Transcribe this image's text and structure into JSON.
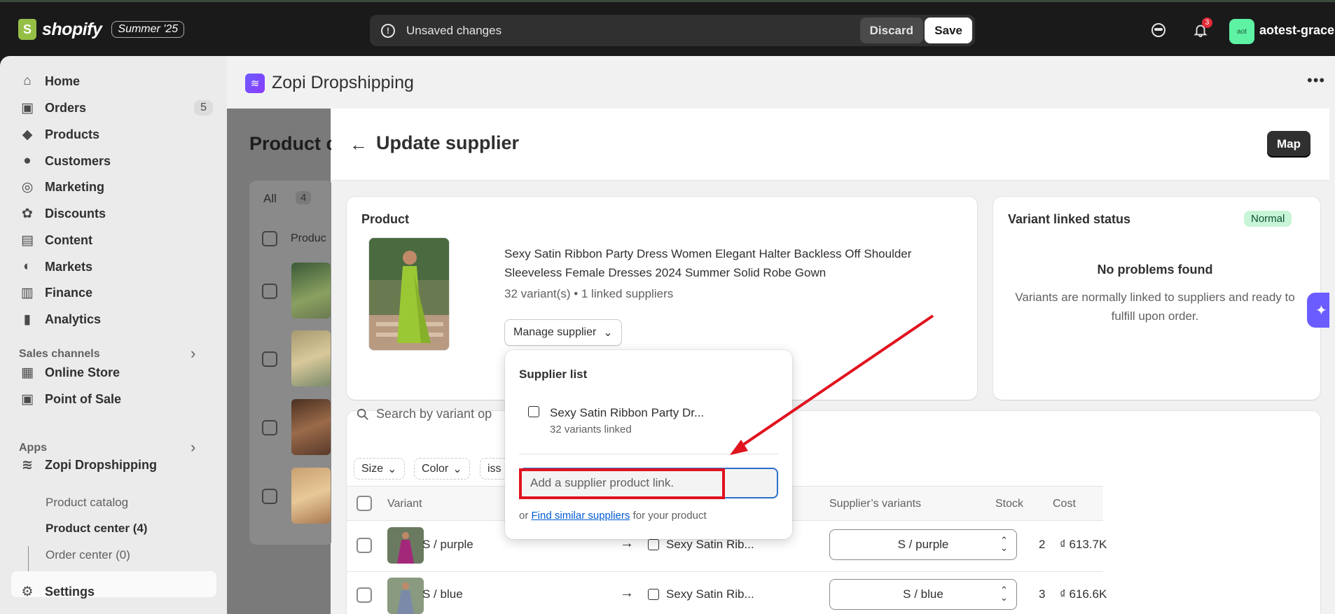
{
  "topbar": {
    "brand": "shopify",
    "edition_badge": "Summer '25",
    "unsaved_text": "Unsaved changes",
    "discard_label": "Discard",
    "save_label": "Save",
    "notification_count": "3",
    "avatar_initials": "aot",
    "user_name": "aotest-grace",
    "accent_color": "#95bf47"
  },
  "sidebar": {
    "items": [
      {
        "label": "Home",
        "icon": "home-icon"
      },
      {
        "label": "Orders",
        "icon": "orders-icon",
        "count": "5"
      },
      {
        "label": "Products",
        "icon": "tag-icon"
      },
      {
        "label": "Customers",
        "icon": "person-icon"
      },
      {
        "label": "Marketing",
        "icon": "target-icon"
      },
      {
        "label": "Discounts",
        "icon": "discount-icon"
      },
      {
        "label": "Content",
        "icon": "image-icon"
      },
      {
        "label": "Markets",
        "icon": "globe-icon"
      },
      {
        "label": "Finance",
        "icon": "bank-icon"
      },
      {
        "label": "Analytics",
        "icon": "chart-icon"
      }
    ],
    "sales_channels_label": "Sales channels",
    "channels": [
      {
        "label": "Online Store",
        "icon": "store-icon"
      },
      {
        "label": "Point of Sale",
        "icon": "pos-icon"
      }
    ],
    "apps_label": "Apps",
    "app_name": "Zopi Dropshipping",
    "app_subitems": [
      "Product catalog",
      "Product center (4)",
      "Order center (0)"
    ],
    "settings_label": "Settings"
  },
  "app_header": {
    "title": "Zopi Dropshipping"
  },
  "background_page": {
    "title": "Product c",
    "tab_all": "All",
    "tab_all_count": "4",
    "column_product": "Produc"
  },
  "panel": {
    "title": "Update supplier",
    "map_label": "Map",
    "product_card": {
      "heading": "Product",
      "name": "Sexy Satin Ribbon Party Dress Women Elegant Halter Backless Off Shoulder Sleeveless Female Dresses 2024 Summer Solid Robe Gown",
      "meta": "32 variant(s) • 1 linked suppliers",
      "manage_label": "Manage supplier"
    },
    "status_card": {
      "heading": "Variant linked status",
      "badge": "Normal",
      "title": "No problems found",
      "description": "Variants are normally linked to suppliers and ready to fulfill upon order."
    },
    "search_placeholder": "Search by variant op",
    "filters": [
      "Size",
      "Color",
      "iss"
    ],
    "table": {
      "headers": {
        "variant": "Variant",
        "supplier_variants": "Supplier’s variants",
        "stock": "Stock",
        "cost": "Cost"
      },
      "rows": [
        {
          "variant": "S / purple",
          "supplier": "Sexy Satin Rib...",
          "supplier_variant": "S / purple",
          "stock": "2",
          "cost": "₫ 613.7K"
        },
        {
          "variant": "S / blue",
          "supplier": "Sexy Satin Rib...",
          "supplier_variant": "S / blue",
          "stock": "3",
          "cost": "₫ 616.6K"
        }
      ]
    }
  },
  "popover": {
    "title": "Supplier list",
    "supplier_name": "Sexy Satin Ribbon Party Dr...",
    "supplier_sub": "32 variants linked",
    "input_placeholder": "Add a supplier product link.",
    "footer_prefix": "or",
    "footer_link": "Find similar suppliers",
    "footer_suffix": "for your product"
  }
}
